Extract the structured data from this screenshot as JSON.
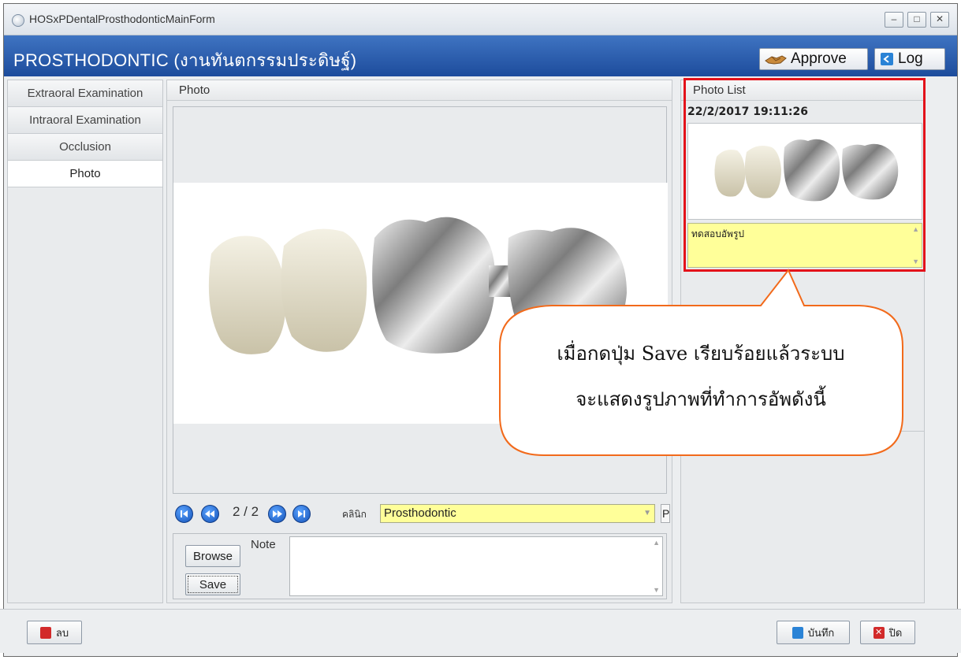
{
  "window": {
    "title": "HOSxPDentalProsthodonticMainForm",
    "controls": [
      "–",
      "□",
      "✕"
    ]
  },
  "header": {
    "title": "PROSTHODONTIC (งานทันตกรรมประดิษฐ์)",
    "approve_label": "Approve",
    "log_label": "Log"
  },
  "sidebar": {
    "items": [
      {
        "label": "Extraoral Examination"
      },
      {
        "label": "Intraoral Examination"
      },
      {
        "label": "Occlusion"
      },
      {
        "label": "Photo"
      }
    ]
  },
  "photo_panel": {
    "title": "Photo",
    "pager": "2 / 2",
    "clinic_label": "คลินิก",
    "clinic_value": "Prosthodontic",
    "p_edge": "P",
    "browse_label": "Browse",
    "save_label": "Save",
    "note_label": "Note",
    "note_value": ""
  },
  "photo_list": {
    "title": "Photo List",
    "date": "22/2/2017 19:11:26",
    "note": "ทดสอบอัพรูป"
  },
  "callout": {
    "line1": "เมื่อกดปุ่ม Save เรียบร้อยแล้วระบบ",
    "line2": "จะแสดงรูปภาพที่ทำการอัพดังนี้"
  },
  "footer": {
    "delete_label": "ลบ",
    "save_label": "บันทึก",
    "close_label": "ปิด"
  },
  "colors": {
    "header_blue": "#1d4c9c",
    "field_yellow": "#ffff99",
    "highlight_red": "#e3121a",
    "callout_orange": "#f26a1b"
  }
}
